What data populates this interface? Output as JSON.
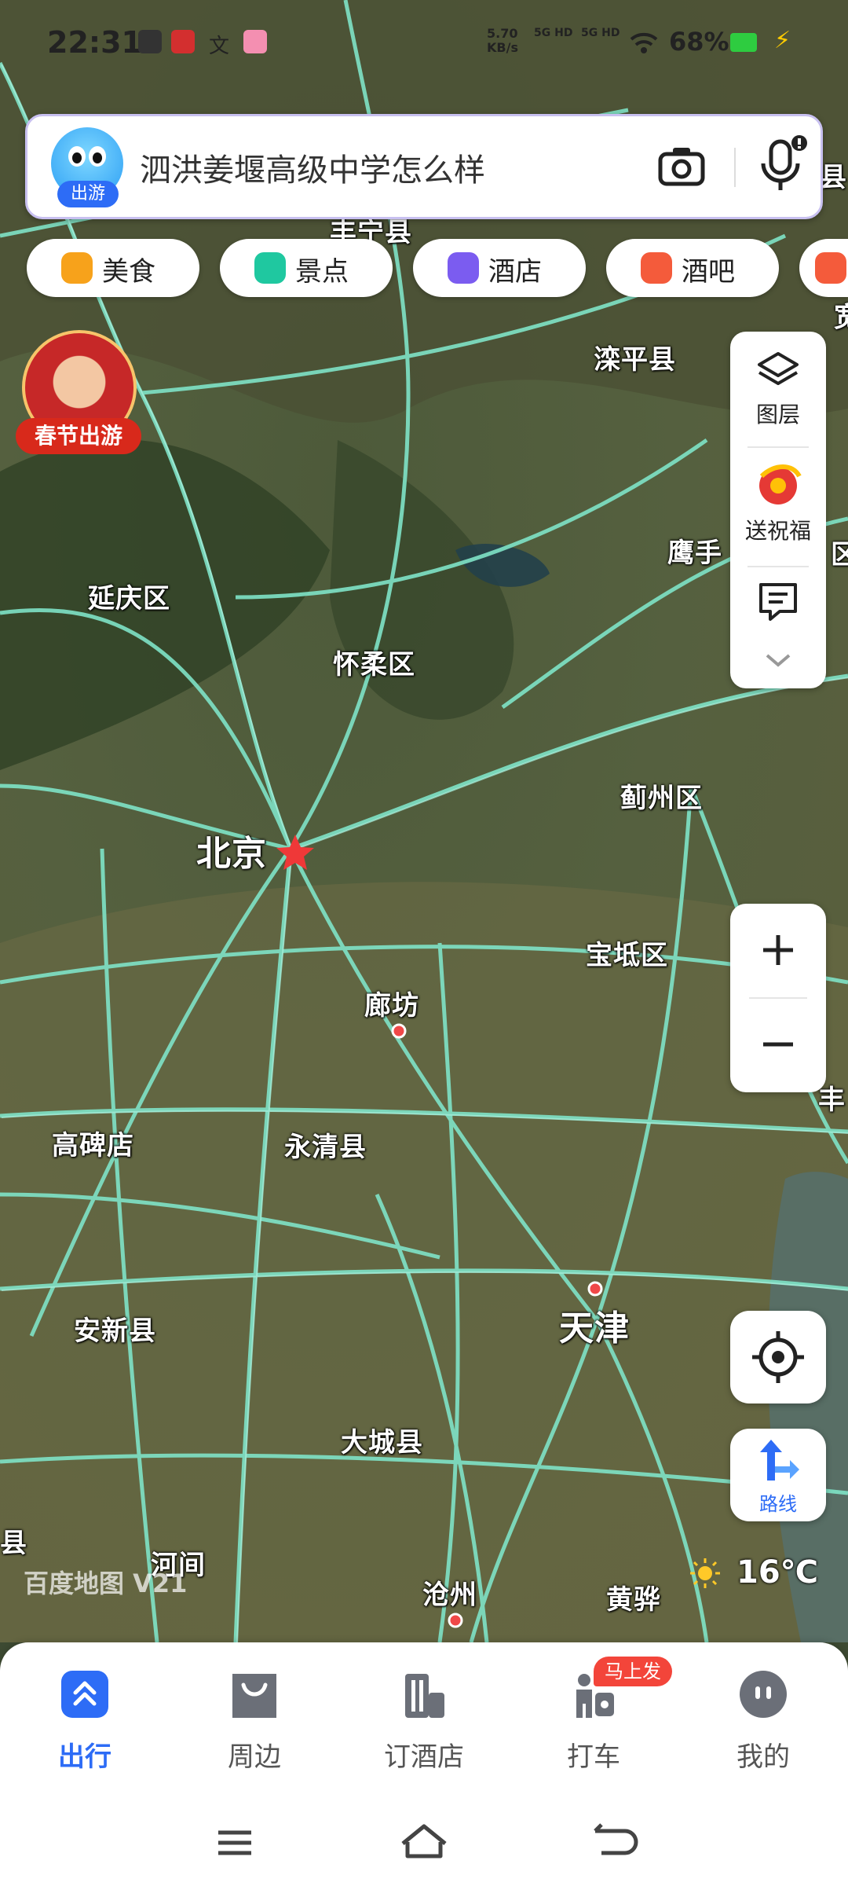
{
  "status_bar": {
    "time": "22:31",
    "net_speed_value": "5.70",
    "net_speed_unit": "KB/s",
    "sig1": "5G HD",
    "sig2": "5G HD",
    "battery": "68%"
  },
  "search": {
    "mascot_tag": "出游",
    "query": "泗洪姜堰高级中学怎么样",
    "icons": {
      "camera": "camera-icon",
      "mic": "microphone-icon"
    }
  },
  "categories": [
    {
      "label": "美食",
      "icon": "food-icon",
      "color": "#f7a21b"
    },
    {
      "label": "景点",
      "icon": "scenic-icon",
      "color": "#1fc8a0"
    },
    {
      "label": "酒店",
      "icon": "hotel-icon",
      "color": "#7b5cf0"
    },
    {
      "label": "酒吧",
      "icon": "bar-icon",
      "color": "#f45b3b"
    }
  ],
  "festival_badge": "春节出游",
  "tools": {
    "layers": "图层",
    "greeting": "送祝福"
  },
  "map": {
    "places": {
      "luanping": "滦平县",
      "fengning": "丰宁县",
      "yingshou": "鹰手",
      "yanqing": "延庆区",
      "huairou": "怀柔区",
      "jizhou": "蓟州区",
      "beijing": "北京",
      "baodi": "宝坻区",
      "langfang": "廊坊",
      "gaobeidian": "高碑店",
      "yongqing": "永清县",
      "anxin": "安新县",
      "tianjin": "天津",
      "dacheng": "大城县",
      "hejian": "河间",
      "cangzhou": "沧州",
      "huanghua": "黄骅",
      "edge_right_top": "宽",
      "edge_right_mid": "区",
      "edge_right_low": "丰",
      "edge_left": "县",
      "edge_search": "县"
    },
    "version": "百度地图 V21",
    "route_label": "路线",
    "weather_temp": "16℃"
  },
  "bottom_nav": [
    {
      "label": "出行",
      "icon": "travel-icon",
      "active": true
    },
    {
      "label": "周边",
      "icon": "nearby-icon",
      "active": false
    },
    {
      "label": "订酒店",
      "icon": "hotel-booking-icon",
      "active": false
    },
    {
      "label": "打车",
      "icon": "taxi-icon",
      "active": false
    },
    {
      "label": "我的",
      "icon": "profile-icon",
      "active": false
    }
  ],
  "taxi_badge": "马上发",
  "colors": {
    "accent": "#2d6cf6",
    "road": "#7fe3c7"
  }
}
